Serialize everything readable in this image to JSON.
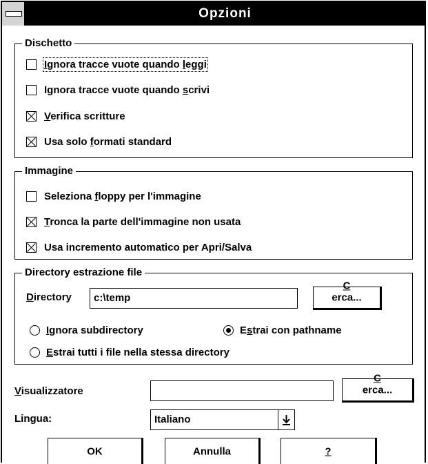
{
  "window": {
    "title": "Opzioni"
  },
  "dischetto": {
    "label": "Dischetto",
    "items": [
      {
        "pre": "",
        "u": "I",
        "post": "gnora tracce vuote quando ",
        "u2": "l",
        "post2": "eggi",
        "checked": false
      },
      {
        "pre": "Ignora tracce vuote quando ",
        "u": "s",
        "post": "crivi",
        "u2": "",
        "post2": "",
        "checked": false
      },
      {
        "pre": "",
        "u": "V",
        "post": "erifica scritture",
        "u2": "",
        "post2": "",
        "checked": true
      },
      {
        "pre": "Usa solo ",
        "u": "f",
        "post": "ormati standard",
        "u2": "",
        "post2": "",
        "checked": true
      }
    ]
  },
  "immagine": {
    "label": "Immagine",
    "items": [
      {
        "pre": "Seleziona ",
        "u": "f",
        "post": "loppy per l'immagine",
        "checked": false
      },
      {
        "pre": "",
        "u": "T",
        "post": "ronca la parte dell'immagine non usata",
        "checked": true
      },
      {
        "pre": "Usa incremento automatico per Apri/Salva",
        "u": "",
        "post": "",
        "checked": true
      }
    ]
  },
  "estrazione": {
    "label": "Directory estrazione file",
    "directory_label_u": "D",
    "directory_label_rest": "irectory",
    "directory_value": "c:\\temp",
    "browse_u": "C",
    "browse_rest": "erca...",
    "radio_ignore_u": "I",
    "radio_ignore_rest": "gnora subdirectory",
    "radio_path_pre": "E",
    "radio_path_u": "s",
    "radio_path_rest": "trai con pathname",
    "radio_same_u": "E",
    "radio_same_rest": "strai tutti i file nella stessa directory",
    "selected": "pathname"
  },
  "visualizzatore": {
    "label_u": "V",
    "label_rest": "isualizzatore",
    "value": "",
    "browse_u": "C",
    "browse_rest": "erca..."
  },
  "lingua": {
    "label_pre": "Lin",
    "label_u": "g",
    "label_rest": "ua:",
    "selected": "Italiano"
  },
  "buttons": {
    "ok": "OK",
    "annulla": "Annulla",
    "help_u": "?"
  }
}
